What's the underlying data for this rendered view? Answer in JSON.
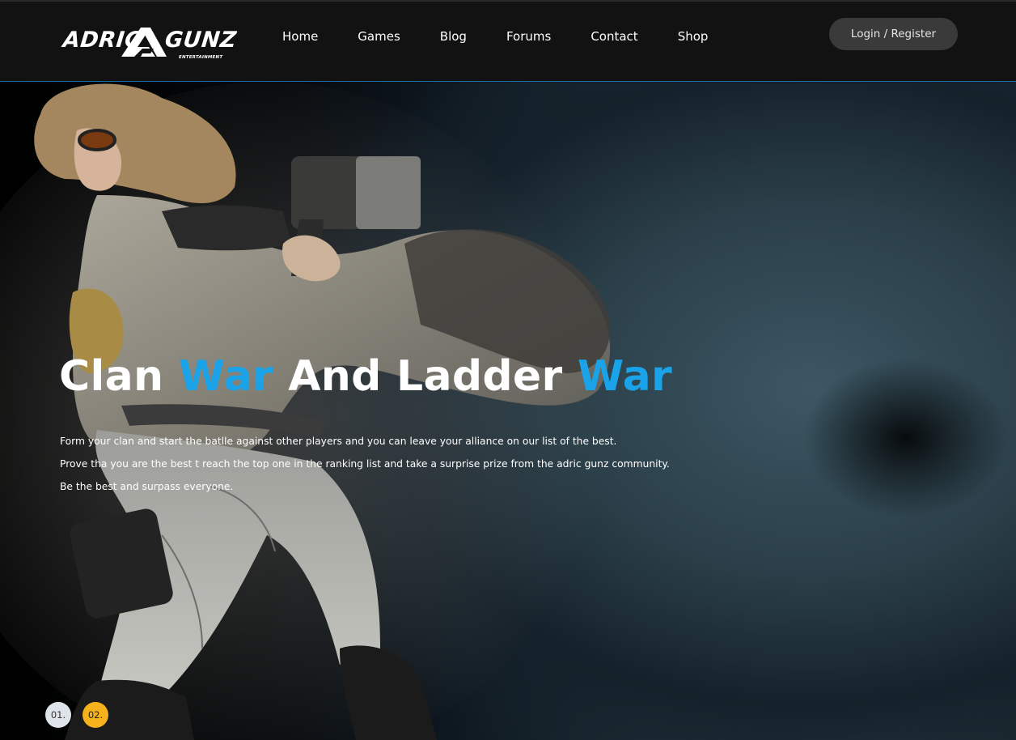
{
  "brand": {
    "name_left": "ADRIC",
    "name_right": "GUNZ",
    "subtitle": "ENTERTAINMENT"
  },
  "nav": {
    "items": [
      {
        "label": "Home"
      },
      {
        "label": "Games"
      },
      {
        "label": "Blog"
      },
      {
        "label": "Forums"
      },
      {
        "label": "Contact"
      },
      {
        "label": "Shop"
      }
    ],
    "login_label": "Login / Register"
  },
  "hero": {
    "title_parts": [
      "Clan ",
      "War",
      " And Ladder ",
      "War"
    ],
    "description": [
      "Form your clan and start the batlle against other players and you can leave your alliance on our list of the best.",
      "Prove tha you are the best t reach the top one in the ranking list and take a surprise prize from the adric gunz community.",
      "Be the best and surpass everyone."
    ]
  },
  "slider": {
    "slides": [
      {
        "label": "01.",
        "active": false
      },
      {
        "label": "02.",
        "active": true
      }
    ]
  },
  "colors": {
    "accent_blue": "#1aa3e8",
    "active_slide": "#f5b21c",
    "header_bg": "#121212",
    "login_bg": "#3a3a3a"
  },
  "icons": {
    "hero_background": "character-artwork"
  }
}
